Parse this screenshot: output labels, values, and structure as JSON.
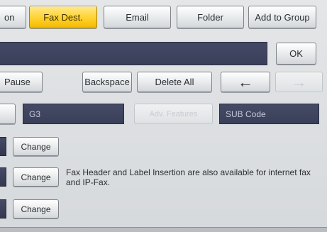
{
  "tabs": [
    {
      "label": "on",
      "active": false
    },
    {
      "label": "Fax Dest.",
      "active": true
    },
    {
      "label": "Email",
      "active": false
    },
    {
      "label": "Folder",
      "active": false
    },
    {
      "label": "Add to Group",
      "active": false
    }
  ],
  "destination_field": {
    "value": ""
  },
  "ok_label": "OK",
  "keys": {
    "pause": "Pause",
    "backspace": "Backspace",
    "delete_all": "Delete All",
    "arrow_left": "←",
    "arrow_right": "→"
  },
  "line_field": {
    "value": "G3"
  },
  "adv_features_label": "Adv. Features",
  "sub_code_label": "SUB Code",
  "change_buttons": [
    "Change",
    "Change",
    "Change"
  ],
  "note_text": "Fax Header and Label Insertion are also available for internet fax and IP-Fax.",
  "colors": {
    "active_tab": "#ffd02a",
    "field_dark": "#3a3f59"
  }
}
